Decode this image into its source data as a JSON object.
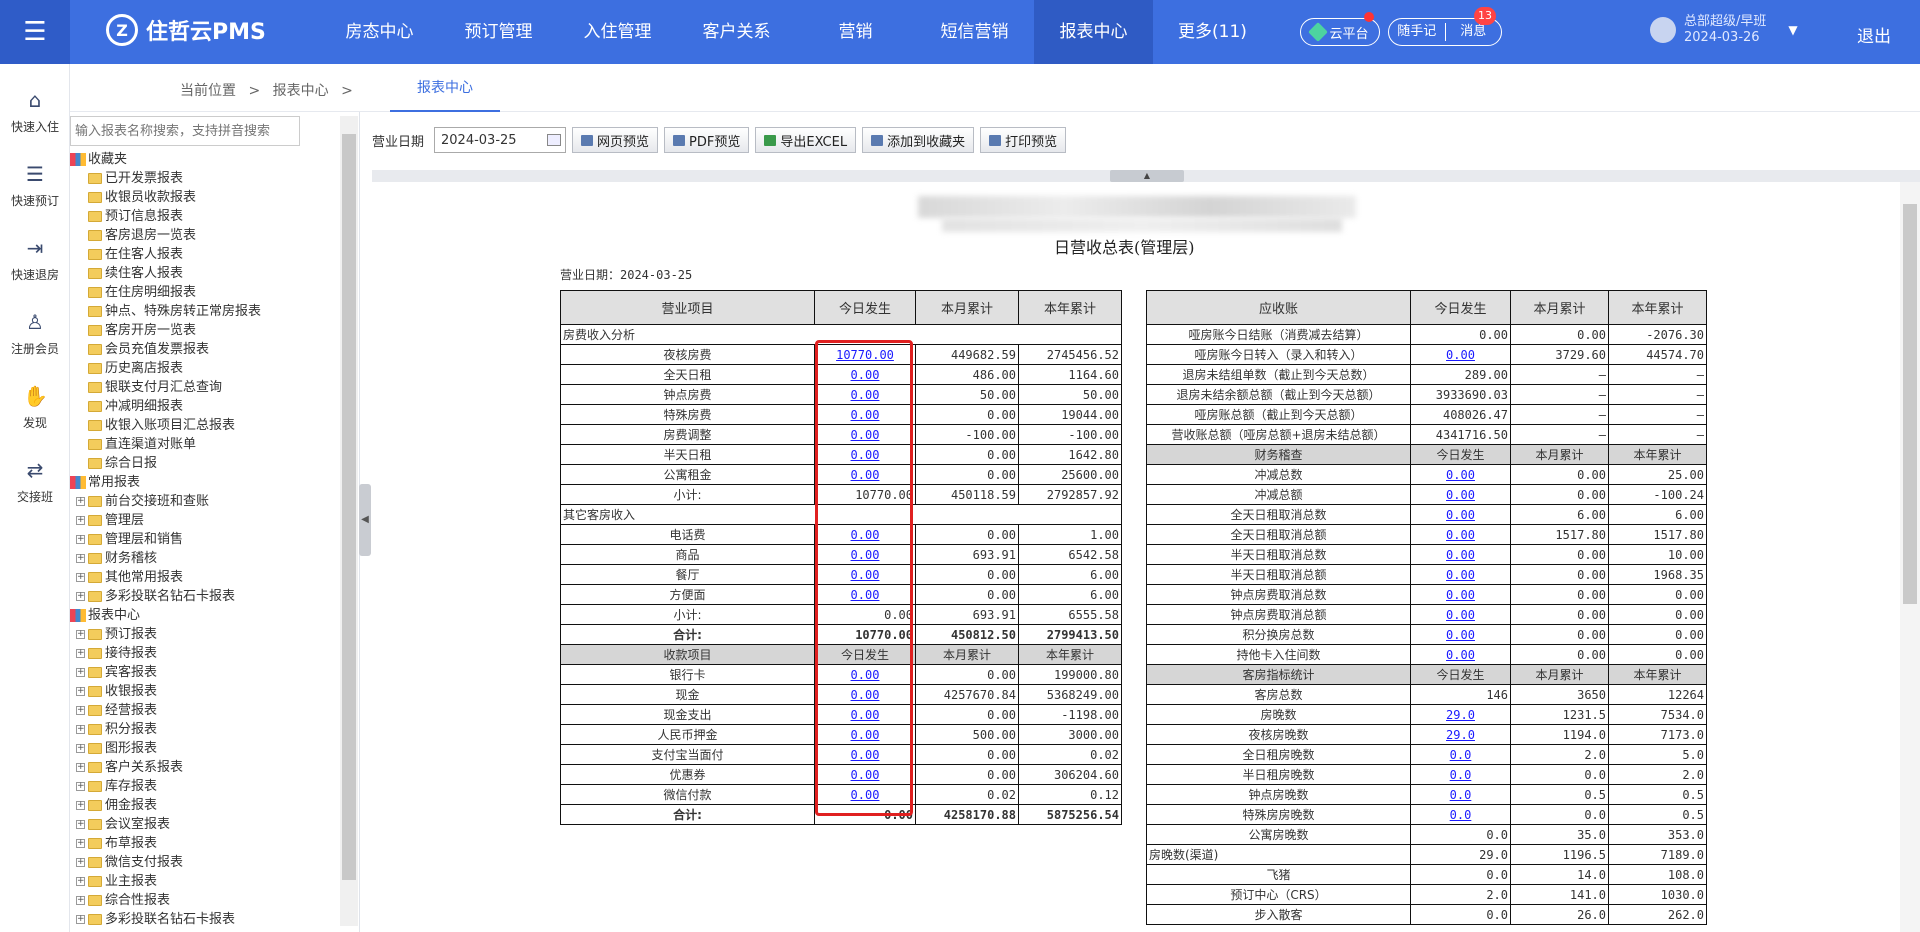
{
  "app": {
    "title": "住哲云PMS",
    "logo_mark": "Z"
  },
  "nav": [
    "房态中心",
    "预订管理",
    "入住管理",
    "客户关系",
    "营销",
    "短信营销",
    "报表中心",
    "更多(11)"
  ],
  "top_right": {
    "cloud": "云平台",
    "notes": "随手记",
    "messages": "消息",
    "badge": "13",
    "user_name": "总部超级/早班",
    "user_date": "2024-03-26",
    "logout": "退出"
  },
  "quick_actions": [
    {
      "label": "快速入住",
      "icon": "home-icon"
    },
    {
      "label": "快速预订",
      "icon": "booking-icon"
    },
    {
      "label": "快速退房",
      "icon": "checkout-icon"
    },
    {
      "label": "注册会员",
      "icon": "member-icon"
    },
    {
      "label": "发现",
      "icon": "discover-icon"
    },
    {
      "label": "交接班",
      "icon": "shift-icon"
    }
  ],
  "breadcrumb": {
    "current": "当前位置",
    "sep": ">",
    "section": "报表中心",
    "tab": "报表中心"
  },
  "tree": {
    "search_placeholder": "输入报表名称搜索，支持拼音搜索",
    "favorites_label": "收藏夹",
    "favorites": [
      "已开发票报表",
      "收银员收款报表",
      "预订信息报表",
      "客房退房一览表",
      "在住客人报表",
      "续住客人报表",
      "在住房明细报表",
      "钟点、特殊房转正常房报表",
      "客房开房一览表",
      "会员充值发票报表",
      "历史离店报表",
      "银联支付月汇总查询",
      "冲减明细报表",
      "收银入账项目汇总报表",
      "直连渠道对账单",
      "综合日报"
    ],
    "common_label": "常用报表",
    "common": [
      "前台交接班和查账",
      "管理层",
      "管理层和销售",
      "财务稽核",
      "其他常用报表",
      "多彩投联名钻石卡报表"
    ],
    "center_label": "报表中心",
    "center": [
      "预订报表",
      "接待报表",
      "宾客报表",
      "收银报表",
      "经营报表",
      "积分报表",
      "图形报表",
      "客户关系报表",
      "库存报表",
      "佣金报表",
      "会议室报表",
      "布草报表",
      "微信支付报表",
      "业主报表",
      "综合性报表",
      "多彩投联名钻石卡报表"
    ]
  },
  "toolbar": {
    "date_label": "营业日期",
    "date_value": "2024-03-25",
    "web_preview": "网页预览",
    "pdf_preview": "PDF预览",
    "export_excel": "导出EXCEL",
    "add_favorite": "添加到收藏夹",
    "print_preview": "打印预览"
  },
  "report": {
    "title": "日营收总表(管理层)",
    "date_line": "营业日期：2024-03-25",
    "left": {
      "headers": [
        "营业项目",
        "今日发生",
        "本月累计",
        "本年累计"
      ],
      "sections": [
        {
          "title": "房费收入分析",
          "rows": [
            [
              "夜核房费",
              "10770.00",
              "449682.59",
              "2745456.52"
            ],
            [
              "全天日租",
              "0.00",
              "486.00",
              "1164.60"
            ],
            [
              "钟点房费",
              "0.00",
              "50.00",
              "50.00"
            ],
            [
              "特殊房费",
              "0.00",
              "0.00",
              "19044.00"
            ],
            [
              "房费调整",
              "0.00",
              "-100.00",
              "-100.00"
            ],
            [
              "半天日租",
              "0.00",
              "0.00",
              "1642.80"
            ],
            [
              "公寓租金",
              "0.00",
              "0.00",
              "25600.00"
            ]
          ],
          "subtotal": [
            "小计:",
            "10770.00",
            "450118.59",
            "2792857.92"
          ]
        },
        {
          "title": "其它客房收入",
          "rows": [
            [
              "电话费",
              "0.00",
              "0.00",
              "1.00"
            ],
            [
              "商品",
              "0.00",
              "693.91",
              "6542.58"
            ],
            [
              "餐厅",
              "0.00",
              "0.00",
              "6.00"
            ],
            [
              "方便面",
              "0.00",
              "0.00",
              "6.00"
            ]
          ],
          "subtotal": [
            "小计:",
            "0.00",
            "693.91",
            "6555.58"
          ]
        }
      ],
      "total": [
        "合计:",
        "10770.00",
        "450812.50",
        "2799413.50"
      ],
      "pay_headers": [
        "收款项目",
        "今日发生",
        "本月累计",
        "本年累计"
      ],
      "pay_rows": [
        [
          "银行卡",
          "0.00",
          "0.00",
          "199000.80"
        ],
        [
          "现金",
          "0.00",
          "4257670.84",
          "5368249.00"
        ],
        [
          "现金支出",
          "0.00",
          "0.00",
          "-1198.00"
        ],
        [
          "人民币押金",
          "0.00",
          "500.00",
          "3000.00"
        ],
        [
          "支付宝当面付",
          "0.00",
          "0.00",
          "0.02"
        ],
        [
          "优惠券",
          "0.00",
          "0.00",
          "306204.60"
        ],
        [
          "微信付款",
          "0.00",
          "0.02",
          "0.12"
        ]
      ],
      "pay_total": [
        "合计:",
        "0.00",
        "4258170.88",
        "5875256.54"
      ]
    },
    "right": {
      "headers": [
        "应收账",
        "今日发生",
        "本月累计",
        "本年累计"
      ],
      "ar_rows": [
        [
          "哑房账今日结账（消费减去结算）",
          "0.00",
          "0.00",
          "-2076.30"
        ],
        [
          "哑房账今日转入（录入和转入）",
          "0.00",
          "3729.60",
          "44574.70"
        ],
        [
          "退房未结组单数（截止到今天总数）",
          "289.00",
          "—",
          "—"
        ],
        [
          "退房未结余额总额（截止到今天总额）",
          "3933690.03",
          "—",
          "—"
        ],
        [
          "哑房账总额（截止到今天总额）",
          "408026.47",
          "—",
          "—"
        ],
        [
          "营收账总额（哑房总额+退房未结总额）",
          "4341716.50",
          "—",
          "—"
        ]
      ],
      "audit_headers": [
        "财务稽查",
        "今日发生",
        "本月累计",
        "本年累计"
      ],
      "audit_rows": [
        [
          "冲减总数",
          "0.00",
          "0.00",
          "25.00"
        ],
        [
          "冲减总额",
          "0.00",
          "0.00",
          "-100.24"
        ],
        [
          "全天日租取消总数",
          "0.00",
          "6.00",
          "6.00"
        ],
        [
          "全天日租取消总额",
          "0.00",
          "1517.80",
          "1517.80"
        ],
        [
          "半天日租取消总数",
          "0.00",
          "0.00",
          "10.00"
        ],
        [
          "半天日租取消总额",
          "0.00",
          "0.00",
          "1968.35"
        ],
        [
          "钟点房费取消总数",
          "0.00",
          "0.00",
          "0.00"
        ],
        [
          "钟点房费取消总额",
          "0.00",
          "0.00",
          "0.00"
        ],
        [
          "积分换房总数",
          "0.00",
          "0.00",
          "0.00"
        ],
        [
          "持他卡入住间数",
          "0.00",
          "0.00",
          "0.00"
        ]
      ],
      "guest_headers": [
        "客房指标统计",
        "今日发生",
        "本月累计",
        "本年累计"
      ],
      "guest_rows": [
        [
          "客房总数",
          "146",
          "3650",
          "12264"
        ],
        [
          "房晚数",
          "29.0",
          "1231.5",
          "7534.0"
        ],
        [
          "夜核房晚数",
          "29.0",
          "1194.0",
          "7173.0"
        ],
        [
          "全日租房晚数",
          "0.0",
          "2.0",
          "5.0"
        ],
        [
          "半日租房晚数",
          "0.0",
          "0.0",
          "2.0"
        ],
        [
          "钟点房晚数",
          "0.0",
          "0.5",
          "0.5"
        ],
        [
          "特殊房房晚数",
          "0.0",
          "0.0",
          "0.5"
        ],
        [
          "公寓房晚数",
          "0.0",
          "35.0",
          "353.0"
        ]
      ],
      "channel_row": [
        "房晚数(渠道)",
        "29.0",
        "1196.5",
        "7189.0"
      ],
      "channel_rows": [
        [
          "飞猪",
          "0.0",
          "14.0",
          "108.0"
        ],
        [
          "预订中心（CRS）",
          "2.0",
          "141.0",
          "1030.0"
        ],
        [
          "步入散客",
          "0.0",
          "26.0",
          "262.0"
        ]
      ]
    }
  }
}
